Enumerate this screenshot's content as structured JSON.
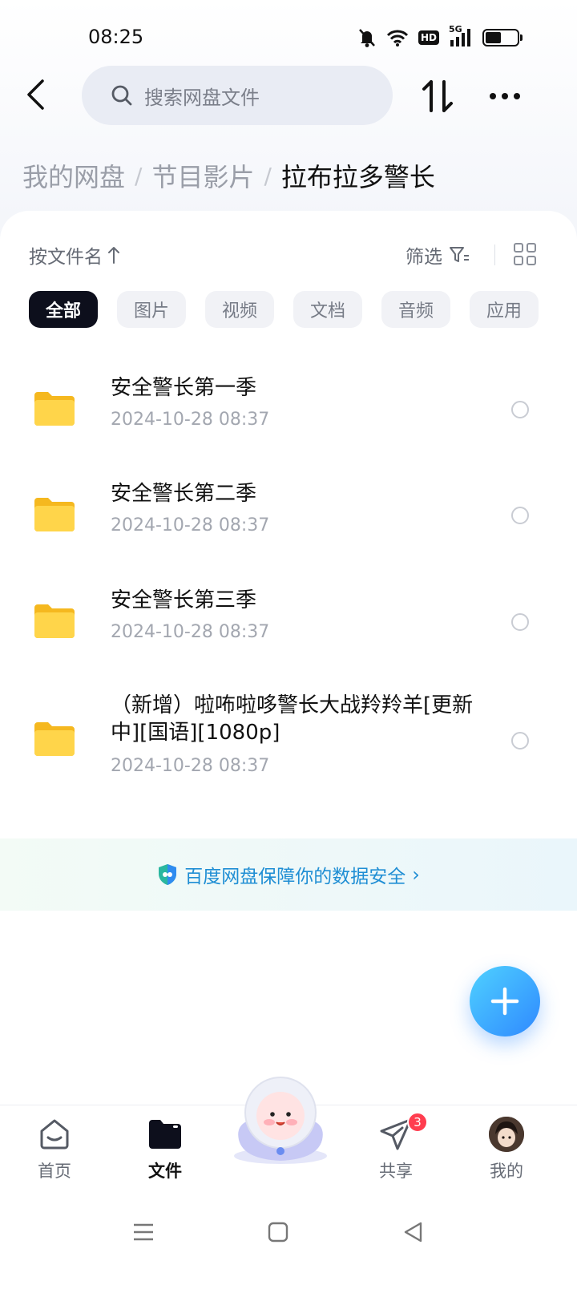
{
  "status_bar": {
    "time": "08:25",
    "network": "5G",
    "hd_label": "HD",
    "battery_level": 0.5,
    "icons": [
      "mute-bell-icon",
      "wifi-icon",
      "hd-icon",
      "signal-icon",
      "battery-icon"
    ]
  },
  "header": {
    "search_placeholder": "搜索网盘文件",
    "icons": [
      "back-icon",
      "search-icon",
      "sort-transfer-icon",
      "more-icon"
    ]
  },
  "breadcrumb": {
    "items": [
      "我的网盘",
      "节目影片",
      "拉布拉多警长"
    ],
    "separator": "/"
  },
  "toolbar": {
    "sort_label": "按文件名",
    "filter_label": "筛选"
  },
  "chips": [
    "全部",
    "图片",
    "视频",
    "文档",
    "音频",
    "应用"
  ],
  "files": [
    {
      "name": "安全警长第一季",
      "date": "2024-10-28  08:37"
    },
    {
      "name": "安全警长第二季",
      "date": "2024-10-28  08:37"
    },
    {
      "name": "安全警长第三季",
      "date": "2024-10-28  08:37"
    },
    {
      "name": "（新增）啦咘啦哆警长大战羚羚羊[更新中][国语][1080p]",
      "date": "2024-10-28  08:37"
    }
  ],
  "security_banner": {
    "text": "百度网盘保障你的数据安全",
    "arrow": "›"
  },
  "bottom_nav": {
    "items": [
      {
        "label": "首页",
        "icon": "home-icon"
      },
      {
        "label": "文件",
        "icon": "folder-icon"
      },
      {
        "label": "共享",
        "icon": "share-send-icon",
        "badge": "3"
      },
      {
        "label": "我的",
        "icon": "avatar"
      }
    ]
  },
  "colors": {
    "accent": "#2f89ff",
    "banner_text": "#1f8ed4",
    "folder": "#ffc933",
    "badge": "#ff3d4f"
  }
}
